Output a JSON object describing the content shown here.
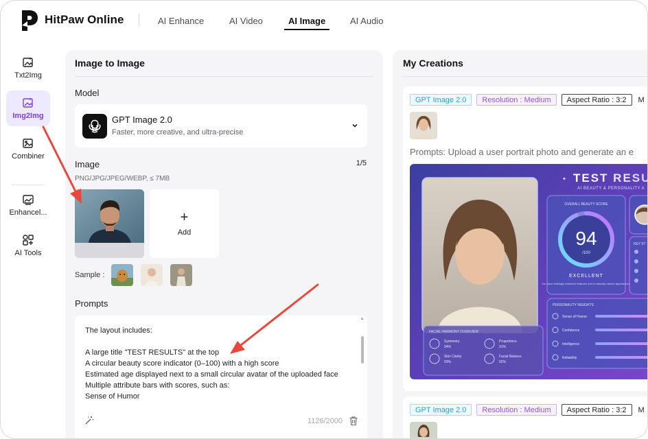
{
  "brand": {
    "name": "HitPaw Online"
  },
  "nav": [
    {
      "label": "AI Enhance",
      "active": false
    },
    {
      "label": "AI Video",
      "active": false
    },
    {
      "label": "AI Image",
      "active": true
    },
    {
      "label": "AI Audio",
      "active": false
    }
  ],
  "sidebar": {
    "items": [
      {
        "label": "Txt2Img",
        "icon": "text-to-image-icon",
        "active": false
      },
      {
        "label": "Img2Img",
        "icon": "image-to-image-icon",
        "active": true
      },
      {
        "label": "Combiner",
        "icon": "combiner-icon",
        "active": false
      },
      {
        "label": "Enhancel...",
        "icon": "enhancer-icon",
        "active": false
      },
      {
        "label": "AI Tools",
        "icon": "ai-tools-icon",
        "active": false
      }
    ]
  },
  "left_panel": {
    "title": "Image to Image",
    "model_label": "Model",
    "model": {
      "name": "GPT Image 2.0",
      "description": "Faster, more creative, and ultra-precise"
    },
    "image_label": "Image",
    "image_count": "1/5",
    "formats": "PNG/JPG/JPEG/WEBP, ≤ 7MB",
    "add_label": "Add",
    "add_symbol": "+",
    "sample_label": "Sample :",
    "prompts_label": "Prompts",
    "prompt_text": "The layout includes:\n\nA large title \"TEST RESULTS\" at the top\nA circular beauty score indicator (0–100) with a high score\nEstimated age displayed next to a small circular avatar of the uploaded face\nMultiple attribute bars with scores, such as:\nSense of Humor",
    "char_count": "1126/2000"
  },
  "right_panel": {
    "title": "My Creations",
    "cards": [
      {
        "tags": [
          "GPT Image 2.0",
          "Resolution : Medium",
          "Aspect Ratio : 3:2",
          "M"
        ],
        "prompt": "Prompts: Upload a user portrait photo and generate an e",
        "result": {
          "title": "TEST RESU",
          "subtitle": "AI BEAUTY & PERSONALITY A",
          "score_label": "OVERALL BEAUTY SCORE",
          "score": "94",
          "score_max": "/100",
          "rating": "EXCELLENT",
          "rating_note": "You have strikingly balanced features and a naturally radiant appearance.",
          "key_label": "KEY ST",
          "facial_label": "FACIAL HARMONY OVERVIEW",
          "facial": [
            {
              "name": "Symmetry",
              "value": "94%"
            },
            {
              "name": "Proportions",
              "value": "91%"
            },
            {
              "name": "Skin Clarity",
              "value": "93%"
            },
            {
              "name": "Facial Balance",
              "value": "92%"
            }
          ],
          "insights_label": "PERSONALITY INSIGHTS",
          "insights": [
            {
              "name": "Sense of Humor",
              "value": 0.8
            },
            {
              "name": "Confidence",
              "value": 0.85
            },
            {
              "name": "Intelligence",
              "value": 0.9
            },
            {
              "name": "Reliability",
              "value": 0.87
            }
          ]
        }
      },
      {
        "tags": [
          "GPT Image 2.0",
          "Resolution : Medium",
          "Aspect Ratio : 3:2",
          "M"
        ]
      }
    ]
  },
  "colors": {
    "accent": "#7b3fe4",
    "arrow": "#e8473b",
    "tag_cyan": "#23a6c8",
    "tag_purple": "#8d57e8"
  }
}
